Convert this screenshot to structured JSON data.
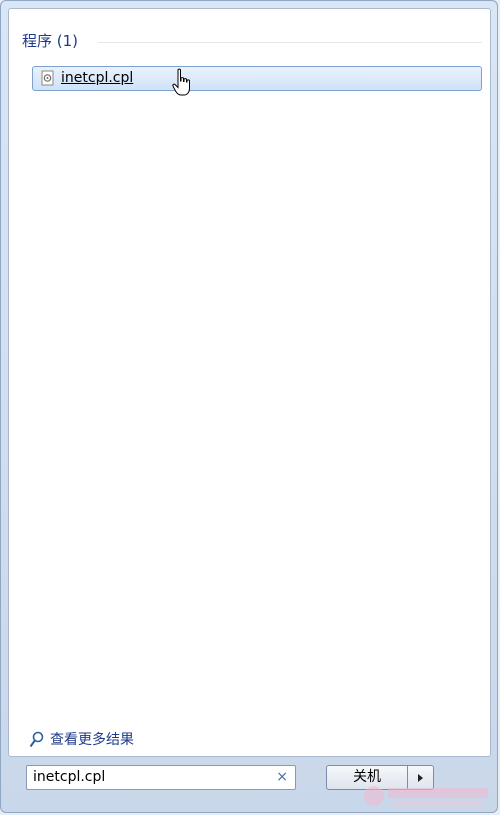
{
  "results": {
    "group_title": "程序 (1)",
    "items": [
      {
        "label": "inetcpl.cpl",
        "icon": "control-panel-file-icon"
      }
    ]
  },
  "see_more": {
    "label": "查看更多结果",
    "icon": "magnifier-icon"
  },
  "search": {
    "value": "inetcpl.cpl",
    "clear_symbol": "×"
  },
  "shutdown": {
    "label": "关机"
  },
  "colors": {
    "accent_text": "#1e3a8a",
    "selection_border": "#7da2ce",
    "frame": "#c9d7ea"
  }
}
